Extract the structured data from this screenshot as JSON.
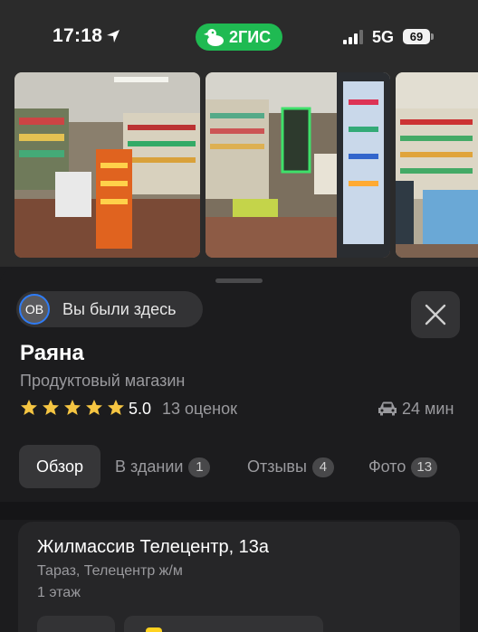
{
  "status_bar": {
    "time": "17:18",
    "network": "5G",
    "battery": "69"
  },
  "brand": {
    "label": "2ГИС",
    "color": "#1fba52"
  },
  "place": {
    "visited_avatar": "ОВ",
    "visited_label": "Вы были здесь",
    "name": "Раяна",
    "category": "Продуктовый магазин",
    "rating_value": "5.0",
    "rating_stars": 5,
    "rating_count": "13 оценок",
    "travel_time": "24 мин"
  },
  "tabs": [
    {
      "label": "Обзор",
      "badge": null,
      "active": true
    },
    {
      "label": "В здании",
      "badge": "1",
      "active": false
    },
    {
      "label": "Отзывы",
      "badge": "4",
      "active": false
    },
    {
      "label": "Фото",
      "badge": "13",
      "active": false
    }
  ],
  "address": {
    "street": "Жилмассив Телецентр, 13а",
    "locality": "Тараз, Телецентр ж/м",
    "floor": "1 этаж"
  },
  "colors": {
    "accent_blue": "#2f7cf6",
    "star_gold": "#f5c542"
  },
  "icons": {
    "location": "location-arrow-icon",
    "close": "close-icon",
    "car": "car-icon",
    "star": "star-icon"
  }
}
